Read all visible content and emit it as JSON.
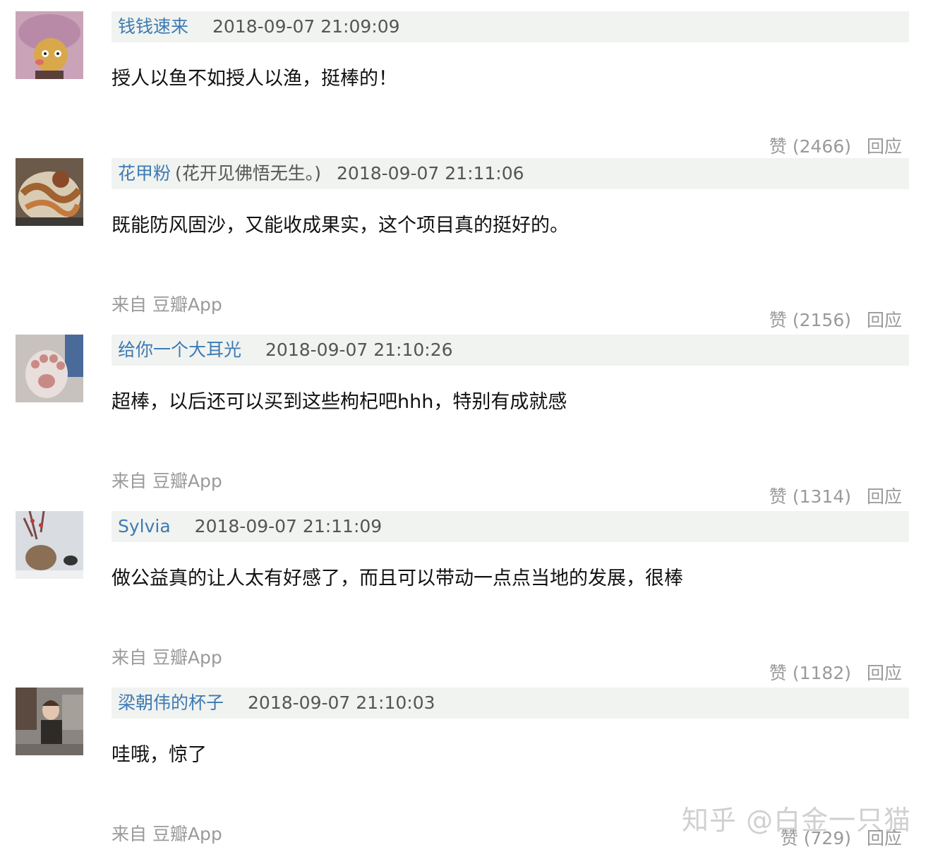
{
  "comments": [
    {
      "username": "钱钱速来",
      "remark": "",
      "timestamp": "2018-09-07 21:09:09",
      "content": "授人以鱼不如授人以渔，挺棒的！",
      "source": "",
      "likes": "赞 (2466)",
      "reply": "回应"
    },
    {
      "username": "花甲粉",
      "remark": "(花开见佛悟无生。)",
      "timestamp": "2018-09-07 21:11:06",
      "content": "既能防风固沙，又能收成果实，这个项目真的挺好的。",
      "source": "来自 豆瓣App",
      "likes": "赞 (2156)",
      "reply": "回应"
    },
    {
      "username": "给你一个大耳光",
      "remark": "",
      "timestamp": "2018-09-07 21:10:26",
      "content": "超棒，以后还可以买到这些枸杞吧hhh，特别有成就感",
      "source": "来自 豆瓣App",
      "likes": "赞 (1314)",
      "reply": "回应"
    },
    {
      "username": "Sylvia",
      "remark": "",
      "timestamp": "2018-09-07 21:11:09",
      "content": "做公益真的让人太有好感了，而且可以带动一点点当地的发展，很棒",
      "source": "来自 豆瓣App",
      "likes": "赞 (1182)",
      "reply": "回应"
    },
    {
      "username": "梁朝伟的杯子",
      "remark": "",
      "timestamp": "2018-09-07 21:10:03",
      "content": "哇哦，惊了",
      "source": "来自 豆瓣App",
      "likes": "赞 (729)",
      "reply": "回应"
    }
  ],
  "watermark": "知乎 @白金一只猫",
  "colors": {
    "username": "#3e7ab3",
    "header_bg": "#f0f3f0",
    "meta_gray": "#9a9a9a",
    "content": "#111111"
  }
}
